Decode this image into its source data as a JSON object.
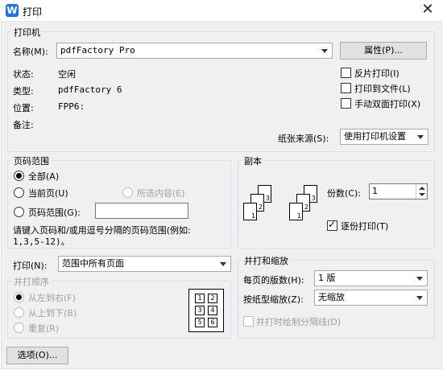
{
  "window": {
    "title": "打印",
    "close": "✕",
    "app_icon_letter": "W"
  },
  "printer": {
    "group_title": "打印机",
    "name_label": "名称(M):",
    "name_value": "pdfFactory Pro",
    "properties_button": "属性(P)...",
    "status_label": "状态:",
    "status_value": "空闲",
    "type_label": "类型:",
    "type_value": "pdfFactory 6",
    "location_label": "位置:",
    "location_value": "FPP6:",
    "comment_label": "备注:",
    "reverse_print": "反片打印(I)",
    "print_to_file": "打印到文件(L)",
    "manual_duplex": "手动双面打印(X)",
    "paper_source_label": "纸张来源(S):",
    "paper_source_value": "使用打印机设置"
  },
  "page_range": {
    "group_title": "页码范围",
    "all": "全部(A)",
    "current": "当前页(U)",
    "selection": "所选内容(E)",
    "pages": "页码范围(G):",
    "pages_value": "",
    "hint": "请键入页码和/或用逗号分隔的页码范围(例如:",
    "hint2": "1,3,5-12)。"
  },
  "copies": {
    "group_title": "副本",
    "count_label": "份数(C):",
    "count_value": "1",
    "collate": "逐份打印(T)",
    "page_labels": [
      "1",
      "2",
      "3"
    ]
  },
  "print_what": {
    "label": "打印(N):",
    "value": "范围中所有页面"
  },
  "order": {
    "group_title": "并打顺序",
    "left_right": "从左到右(F)",
    "top_bottom": "从上到下(B)",
    "repeat": "重复(R)",
    "grid": [
      "1",
      "2",
      "3",
      "4",
      "5",
      "6"
    ]
  },
  "zoom": {
    "group_title": "并打和缩放",
    "pages_per_sheet_label": "每页的版数(H):",
    "pages_per_sheet_value": "1 版",
    "scale_label": "按纸型缩放(Z):",
    "scale_value": "无缩放",
    "draw_lines": "并打时绘制分隔线(D)"
  },
  "options_button": "选项(O)..."
}
